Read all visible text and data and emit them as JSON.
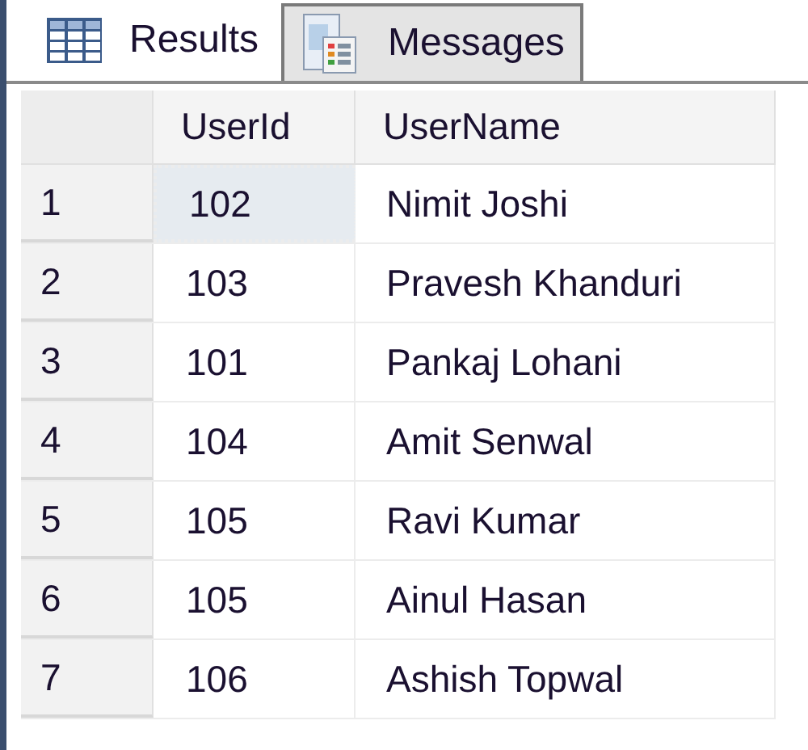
{
  "tabs": [
    {
      "label": "Results",
      "kind": "grid",
      "selected": true
    },
    {
      "label": "Messages",
      "kind": "messages",
      "selected": false
    }
  ],
  "table": {
    "columns": [
      "UserId",
      "UserName"
    ],
    "rows": [
      {
        "number": "1",
        "cells": [
          "102",
          "Nimit Joshi"
        ],
        "selected": true
      },
      {
        "number": "2",
        "cells": [
          "103",
          "Pravesh Khanduri"
        ],
        "selected": false
      },
      {
        "number": "3",
        "cells": [
          "101",
          "Pankaj Lohani"
        ],
        "selected": false
      },
      {
        "number": "4",
        "cells": [
          "104",
          "Amit Senwal"
        ],
        "selected": false
      },
      {
        "number": "5",
        "cells": [
          "105",
          "Ravi Kumar"
        ],
        "selected": false
      },
      {
        "number": "6",
        "cells": [
          "105",
          "Ainul Hasan"
        ],
        "selected": false
      },
      {
        "number": "7",
        "cells": [
          "106",
          "Ashish Topwal"
        ],
        "selected": false
      }
    ]
  }
}
